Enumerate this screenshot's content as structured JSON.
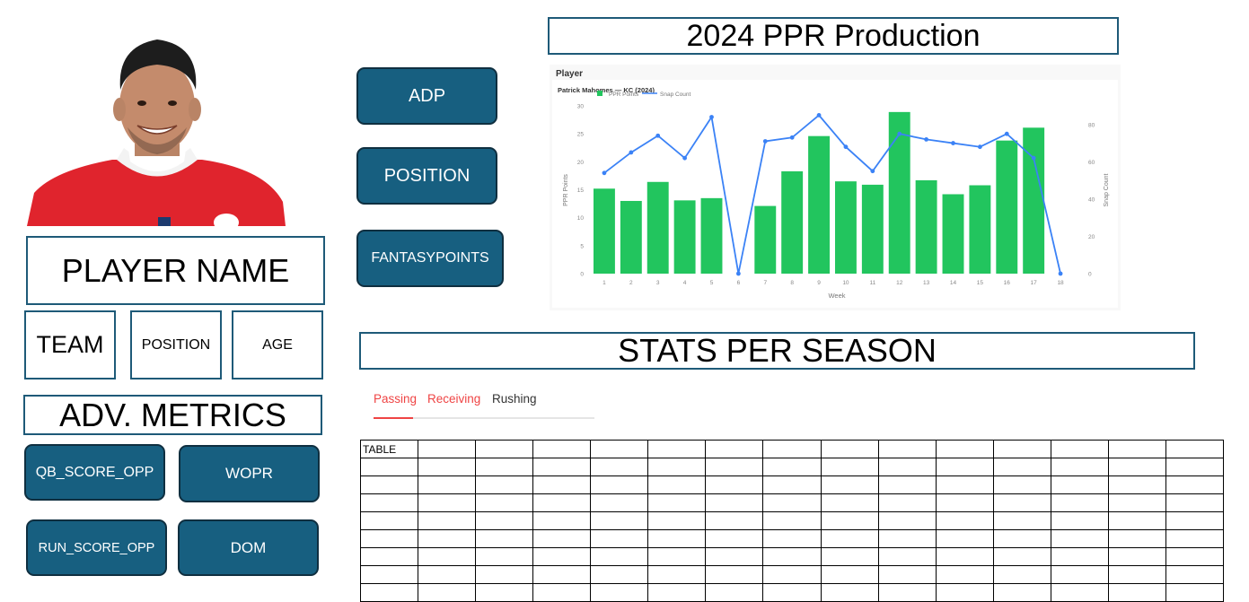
{
  "player": {
    "name_label": "PLAYER NAME",
    "team_label": "TEAM",
    "position_label": "POSITION",
    "age_label": "AGE"
  },
  "adv_metrics": {
    "title": "ADV. METRICS",
    "buttons": [
      "QB_SCORE_OPP",
      "WOPR",
      "RUN_SCORE_OPP",
      "DOM"
    ]
  },
  "filters": {
    "buttons": [
      "ADP",
      "POSITION",
      "FANTASYPOINTS"
    ]
  },
  "production": {
    "title": "2024 PPR Production",
    "header_label": "Player",
    "subtitle": "Patrick Mahomes — KC (2024)"
  },
  "stats": {
    "title": "STATS PER SEASON",
    "tabs": [
      "Passing",
      "Receiving",
      "Rushing"
    ],
    "active_tab": "Passing",
    "table_first_cell": "TABLE",
    "table_cols": 15,
    "table_rows": 9
  },
  "colors": {
    "accent_button": "#175f80",
    "border": "#1e5a78",
    "bar": "#22c55e",
    "line": "#3b82f6",
    "tab_active": "#ef4444"
  },
  "chart_data": {
    "type": "bar",
    "title": "",
    "subtitle": "Patrick Mahomes — KC (2024)",
    "xlabel": "Week",
    "ylabel": "PPR Points",
    "y2label": "Snap Count",
    "categories": [
      "1",
      "2",
      "3",
      "4",
      "5",
      "6",
      "7",
      "8",
      "9",
      "10",
      "11",
      "12",
      "13",
      "14",
      "15",
      "16",
      "17",
      "18"
    ],
    "series": [
      {
        "name": "PPR Points",
        "type": "bar",
        "axis": "left",
        "values": [
          15.2,
          13.0,
          16.4,
          13.1,
          13.5,
          null,
          12.1,
          18.3,
          24.6,
          16.5,
          15.9,
          28.9,
          16.7,
          14.2,
          15.8,
          23.8,
          26.1,
          null
        ]
      },
      {
        "name": "Snap Count",
        "type": "line",
        "axis": "right",
        "values": [
          54,
          65,
          74,
          62,
          84,
          0,
          71,
          73,
          85,
          68,
          55,
          75,
          72,
          70,
          68,
          75,
          62,
          0
        ]
      }
    ],
    "ylim": [
      0,
      30
    ],
    "y2lim": [
      0,
      90
    ],
    "yticks": [
      0,
      5,
      10,
      15,
      20,
      25,
      30
    ],
    "y2ticks": [
      0,
      20,
      40,
      60,
      80
    ],
    "legend": "top-left",
    "grid": false
  }
}
